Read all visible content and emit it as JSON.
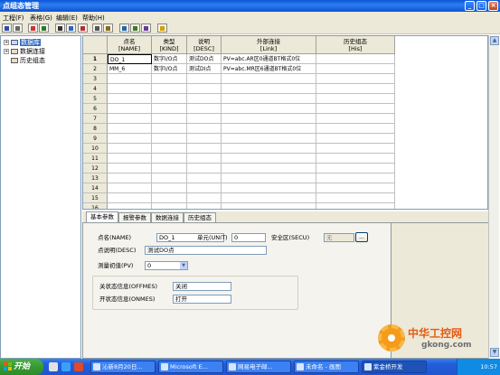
{
  "window": {
    "title": "点组态管理"
  },
  "menu": [
    "工程(F)",
    "表格(G)",
    "编辑(E)",
    "帮助(H)"
  ],
  "tree": [
    {
      "label": "数据库",
      "selected": true
    },
    {
      "label": "数据连接",
      "selected": false
    },
    {
      "label": "历史组态",
      "selected": false
    }
  ],
  "grid": {
    "columns": [
      {
        "name": "点名",
        "code": "[NAME]"
      },
      {
        "name": "类型",
        "code": "[KIND]"
      },
      {
        "name": "说明",
        "code": "[DESC]"
      },
      {
        "name": "外部连接",
        "code": "[Link]"
      },
      {
        "name": "历史组态",
        "code": "[His]"
      }
    ],
    "rows": [
      {
        "num": "1",
        "cells": [
          "DO_1",
          "数字I/O点",
          "测试DO点",
          "PV=abc.AR区0通道BT格式0位",
          ""
        ]
      },
      {
        "num": "2",
        "cells": [
          "MM_6",
          "数字I/O点",
          "测试DI点",
          "PV=abc.MR区6通道BT格式0位",
          ""
        ]
      },
      {
        "num": "3",
        "cells": [
          "",
          "",
          "",
          "",
          ""
        ]
      },
      {
        "num": "4",
        "cells": [
          "",
          "",
          "",
          "",
          ""
        ]
      },
      {
        "num": "5",
        "cells": [
          "",
          "",
          "",
          "",
          ""
        ]
      },
      {
        "num": "6",
        "cells": [
          "",
          "",
          "",
          "",
          ""
        ]
      },
      {
        "num": "7",
        "cells": [
          "",
          "",
          "",
          "",
          ""
        ]
      },
      {
        "num": "8",
        "cells": [
          "",
          "",
          "",
          "",
          ""
        ]
      },
      {
        "num": "9",
        "cells": [
          "",
          "",
          "",
          "",
          ""
        ]
      },
      {
        "num": "10",
        "cells": [
          "",
          "",
          "",
          "",
          ""
        ]
      },
      {
        "num": "11",
        "cells": [
          "",
          "",
          "",
          "",
          ""
        ]
      },
      {
        "num": "12",
        "cells": [
          "",
          "",
          "",
          "",
          ""
        ]
      },
      {
        "num": "13",
        "cells": [
          "",
          "",
          "",
          "",
          ""
        ]
      },
      {
        "num": "14",
        "cells": [
          "",
          "",
          "",
          "",
          ""
        ]
      },
      {
        "num": "15",
        "cells": [
          "",
          "",
          "",
          "",
          ""
        ]
      },
      {
        "num": "16",
        "cells": [
          "",
          "",
          "",
          "",
          ""
        ]
      }
    ]
  },
  "tabs": [
    "基本参数",
    "报警参数",
    "数据连接",
    "历史组态"
  ],
  "form": {
    "name_label": "点名(NAME)",
    "name_value": "DO_1",
    "unit_label": "单元(UNIT)",
    "unit_value": "0",
    "secu_label": "安全区(SECU)",
    "secu_value": "无",
    "browse_label": "...",
    "desc_label": "点说明(DESC)",
    "desc_value": "测试DO点",
    "pv_label": "测量初值(PV)",
    "pv_value": "0",
    "offmes_label": "关状态信息(OFFMES)",
    "offmes_value": "关闭",
    "onmes_label": "开状态信息(ONMES)",
    "onmes_value": "打开"
  },
  "taskbar": {
    "start_label": "开始",
    "tasks": [
      {
        "label": "沁新8月20日...",
        "active": false
      },
      {
        "label": "Microsoft E...",
        "active": false
      },
      {
        "label": "网易电子邮...",
        "active": false
      },
      {
        "label": "未命名 - 画图",
        "active": false
      },
      {
        "label": "紫金桥开发",
        "active": true
      }
    ],
    "clock": "10:57"
  },
  "watermark": {
    "text_cn": "中华工控网",
    "url": "gkong.com"
  }
}
